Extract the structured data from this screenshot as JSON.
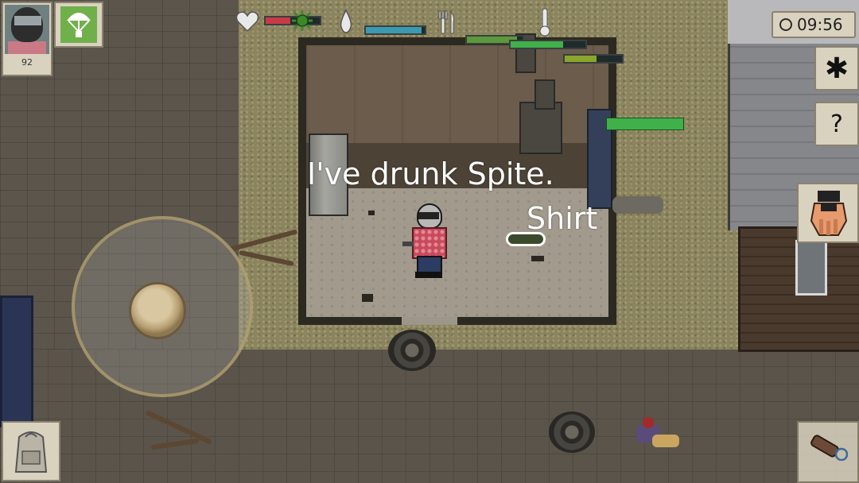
{
  "hud": {
    "portrait": {
      "level": "92"
    },
    "skill_button": {
      "icon": "parachute-icon",
      "color": "#6fb04a"
    },
    "status": {
      "health": {
        "icon": "heart-icon",
        "fill": 0.45,
        "color": "#c83a46"
      },
      "infection": {
        "icon": "virus-icon",
        "color": "#3a8a2a"
      },
      "thirst": {
        "icon": "water-drop-icon",
        "fill": 0.95,
        "color": "#3a9ab0"
      },
      "hunger": {
        "icon": "fork-knife-icon",
        "fill": 0.9,
        "color": "#5a9a3a"
      },
      "temperature": {
        "icon": "thermometer-icon",
        "fill": 0.7,
        "color": "#3fb04a"
      },
      "energy": {
        "icon": "energy-icon",
        "fill": 0.55,
        "color": "#8aa52a"
      }
    },
    "clock": {
      "time": "09:56"
    },
    "buttons": {
      "settings": {
        "icon": "gear-icon",
        "glyph": "✱"
      },
      "quests": {
        "icon": "notebook-question-icon",
        "glyph": "?"
      },
      "attack": {
        "icon": "fist-icon"
      },
      "weapon": {
        "icon": "weapon-swap-icon"
      },
      "backpack": {
        "icon": "backpack-icon"
      }
    }
  },
  "world": {
    "speech_text": "I've drunk Spite.",
    "item_label": "Shirt"
  }
}
